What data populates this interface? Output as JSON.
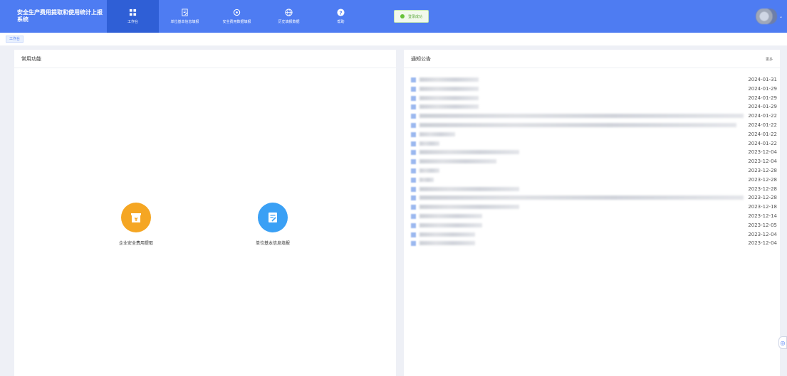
{
  "app": {
    "title": "安全生产费用提取和使用统计上报系统"
  },
  "nav": {
    "items": [
      {
        "label": "工作台",
        "icon": "dashboard-icon"
      },
      {
        "label": "单位基本信息填报",
        "icon": "edit-form-icon"
      },
      {
        "label": "安全费用数据填报",
        "icon": "cycle-icon"
      },
      {
        "label": "历史填报数据",
        "icon": "globe-icon"
      },
      {
        "label": "帮助",
        "icon": "question-icon"
      }
    ],
    "active_index": 0
  },
  "toast": {
    "text": "登录成功",
    "color": "#67c23a"
  },
  "breadcrumb": {
    "current": "工作台"
  },
  "common": {
    "title": "常用功能",
    "items": [
      {
        "label": "企业安全费用提取",
        "icon": "yuan-box-icon",
        "color": "#f5a623"
      },
      {
        "label": "单位基本信息填报",
        "icon": "edit-doc-icon",
        "color": "#3aa0f5"
      }
    ]
  },
  "notices": {
    "title": "通知公告",
    "more_label": "更多",
    "items": [
      {
        "title": "",
        "date": "2024-01-31"
      },
      {
        "title": "",
        "date": "2024-01-29"
      },
      {
        "title": "",
        "date": "2024-01-29"
      },
      {
        "title": "",
        "date": "2024-01-29"
      },
      {
        "title": "",
        "date": "2024-01-22"
      },
      {
        "title": "",
        "date": "2024-01-22"
      },
      {
        "title": "",
        "date": "2024-01-22"
      },
      {
        "title": "",
        "date": "2024-01-22"
      },
      {
        "title": "",
        "date": "2023-12-04"
      },
      {
        "title": "",
        "date": "2023-12-04"
      },
      {
        "title": "",
        "date": "2023-12-28"
      },
      {
        "title": "",
        "date": "2023-12-28"
      },
      {
        "title": "",
        "date": "2023-12-28"
      },
      {
        "title": "",
        "date": "2023-12-28"
      },
      {
        "title": "",
        "date": "2023-12-18"
      },
      {
        "title": "",
        "date": "2023-12-14"
      },
      {
        "title": "",
        "date": "2023-12-05"
      },
      {
        "title": "",
        "date": "2023-12-04"
      },
      {
        "title": "",
        "date": "2023-12-04"
      }
    ]
  },
  "colors": {
    "header": "#4e7cf2",
    "header_active": "#2f5fd6",
    "page_bg": "#eef0f6"
  }
}
